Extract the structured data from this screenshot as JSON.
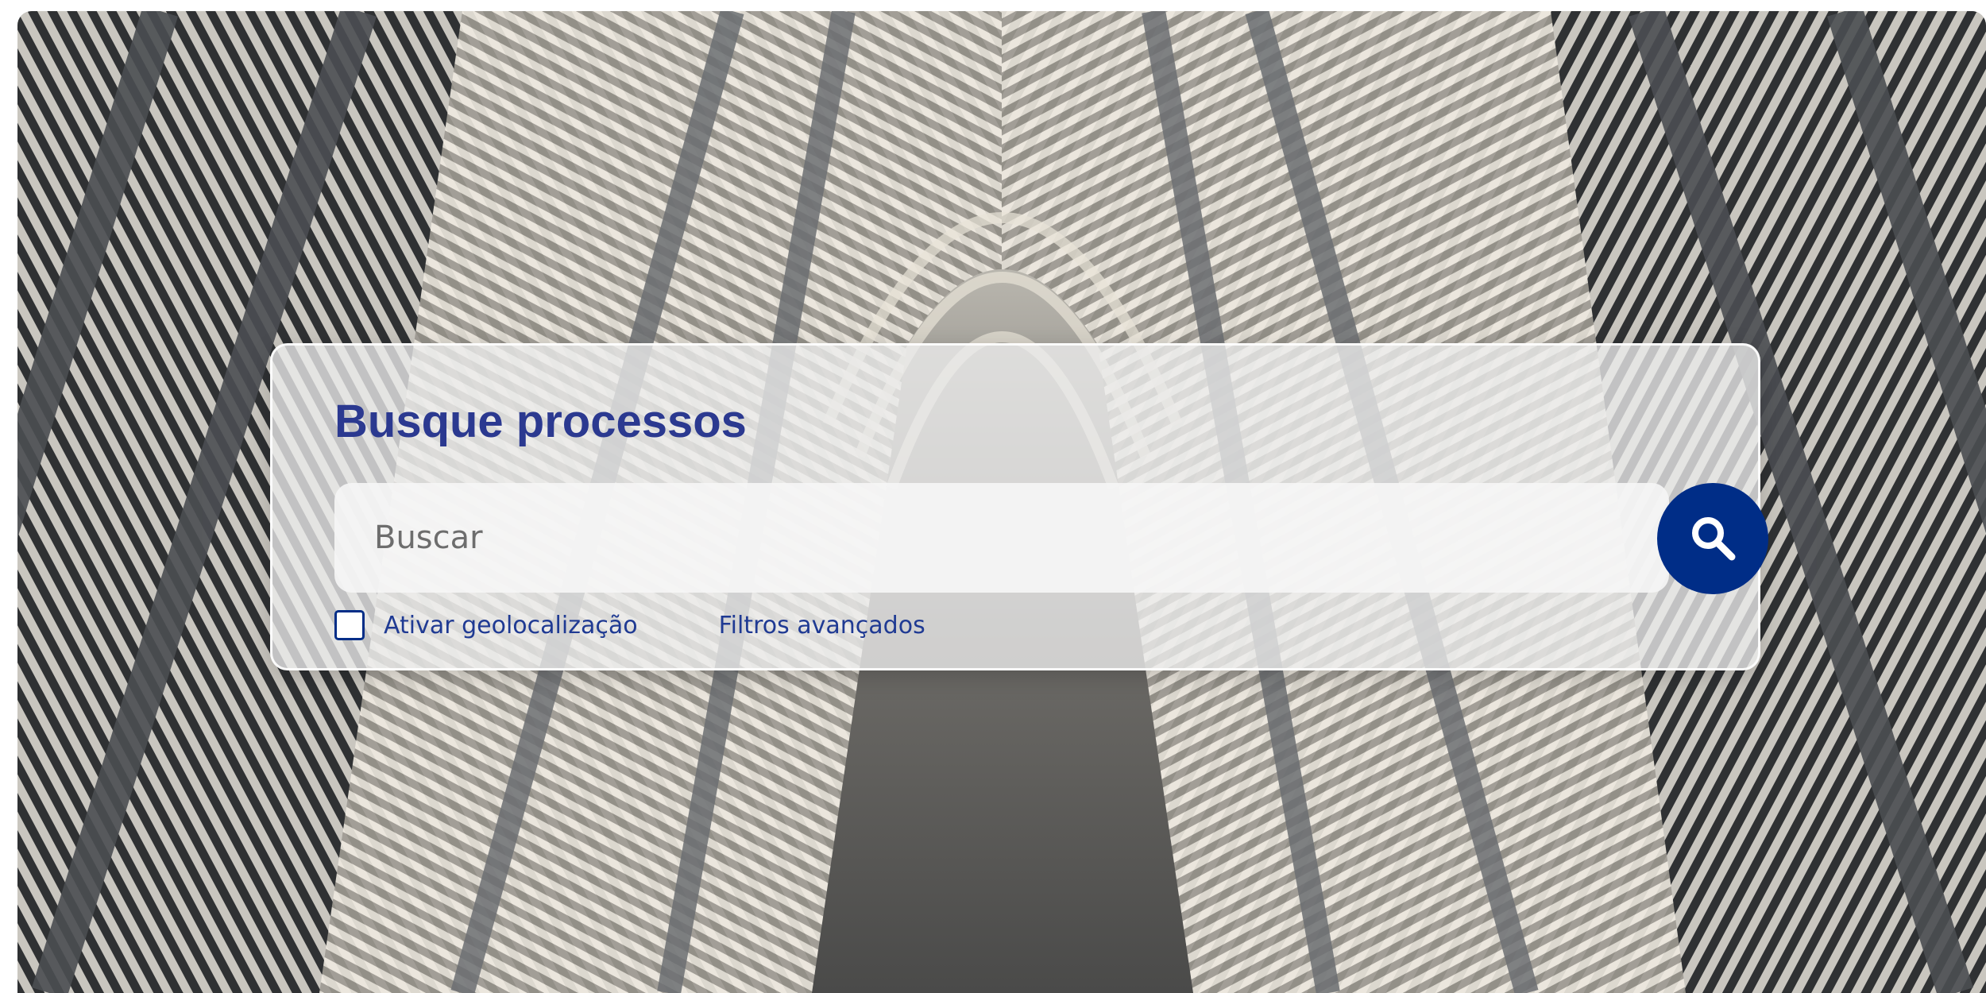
{
  "search_panel": {
    "title": "Busque processos",
    "input_value": "",
    "input_placeholder": "Buscar",
    "search_button_icon": "search-icon",
    "geolocation_checkbox_checked": false,
    "geolocation_label": "Ativar geolocalização",
    "advanced_filters_label": "Filtros avançados"
  },
  "colors": {
    "title": "#2b3990",
    "accent": "#002d87",
    "link": "#1f3a93"
  },
  "background": {
    "image_subject": "architectural-corridor-with-slatted-beams"
  }
}
